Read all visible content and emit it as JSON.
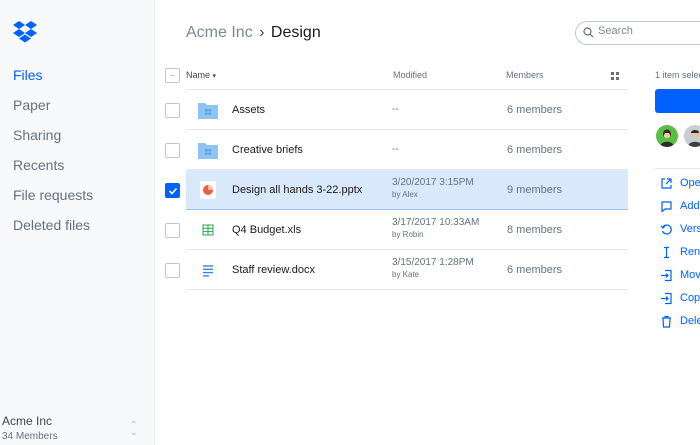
{
  "sidebar": {
    "items": [
      {
        "label": "Files",
        "active": true
      },
      {
        "label": "Paper"
      },
      {
        "label": "Sharing"
      },
      {
        "label": "Recents"
      },
      {
        "label": "File requests"
      },
      {
        "label": "Deleted files"
      }
    ],
    "team": {
      "name": "Acme Inc",
      "count": "34 Members"
    }
  },
  "header": {
    "breadcrumb_parent": "Acme Inc",
    "breadcrumb_sep": "›",
    "breadcrumb_current": "Design",
    "search_placeholder": "Search"
  },
  "table": {
    "columns": {
      "name": "Name",
      "modified": "Modified",
      "members": "Members"
    },
    "rows": [
      {
        "name": "Assets",
        "type": "folder-icon",
        "modified": "--",
        "by": "",
        "members": "6 members"
      },
      {
        "name": "Creative briefs",
        "type": "folder-icon",
        "modified": "--",
        "by": "",
        "members": "6 members"
      },
      {
        "name": "Design all hands 3-22.pptx",
        "type": "pptx-icon",
        "modified": "3/20/2017 3:15PM",
        "by": "by Alex",
        "members": "9 members",
        "selected": true
      },
      {
        "name": "Q4 Budget.xls",
        "type": "spreadsheet-icon",
        "modified": "3/17/2017 10:33AM",
        "by": "by Robin",
        "members": "8 members"
      },
      {
        "name": "Staff review.docx",
        "type": "document-icon",
        "modified": "3/15/2017 1:28PM",
        "by": "by Kate",
        "members": "6 members"
      }
    ]
  },
  "panel": {
    "selected_text": "1 item selec",
    "actions": [
      {
        "label": "Ope",
        "icon": "open-external-icon"
      },
      {
        "label": "Add",
        "icon": "comment-icon"
      },
      {
        "label": "Vers",
        "icon": "history-icon"
      },
      {
        "label": "Ren",
        "icon": "rename-cursor-icon"
      },
      {
        "label": "Mov",
        "icon": "move-icon"
      },
      {
        "label": "Cop",
        "icon": "copy-icon"
      },
      {
        "label": "Dele",
        "icon": "trash-icon"
      }
    ]
  },
  "colors": {
    "accent": "#0061fe",
    "selected_row": "#d9e8fb",
    "folder": "#8dc4f2"
  }
}
